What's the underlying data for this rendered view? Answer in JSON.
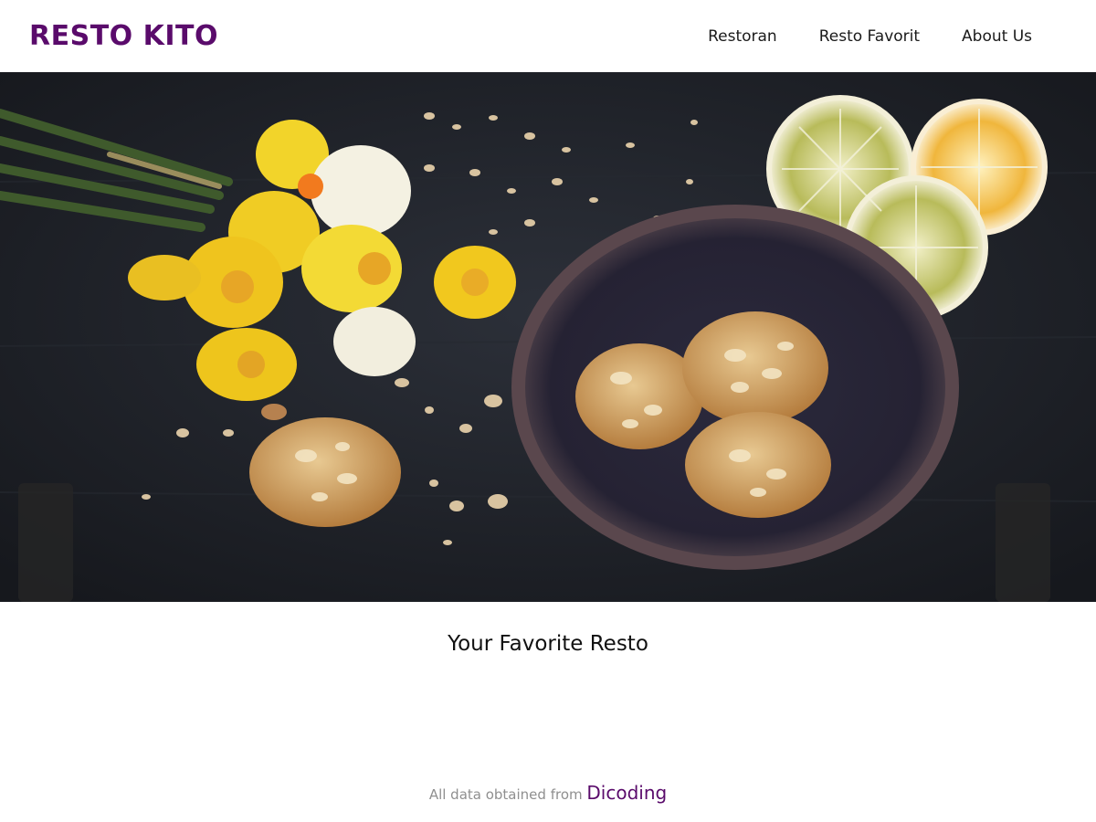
{
  "header": {
    "brand": "RESTO KITO",
    "nav": [
      {
        "label": "Restoran"
      },
      {
        "label": "Resto Favorit"
      },
      {
        "label": "About Us"
      }
    ]
  },
  "hero": {
    "icon": "hero-food-photo"
  },
  "main": {
    "section_title": "Your Favorite Resto"
  },
  "footer": {
    "text": "All data obtained from",
    "link_label": "Dicoding"
  },
  "colors": {
    "brand": "#5a0b6b",
    "accent_bar": "#c0163a",
    "hero_bg": "#1f2229"
  }
}
